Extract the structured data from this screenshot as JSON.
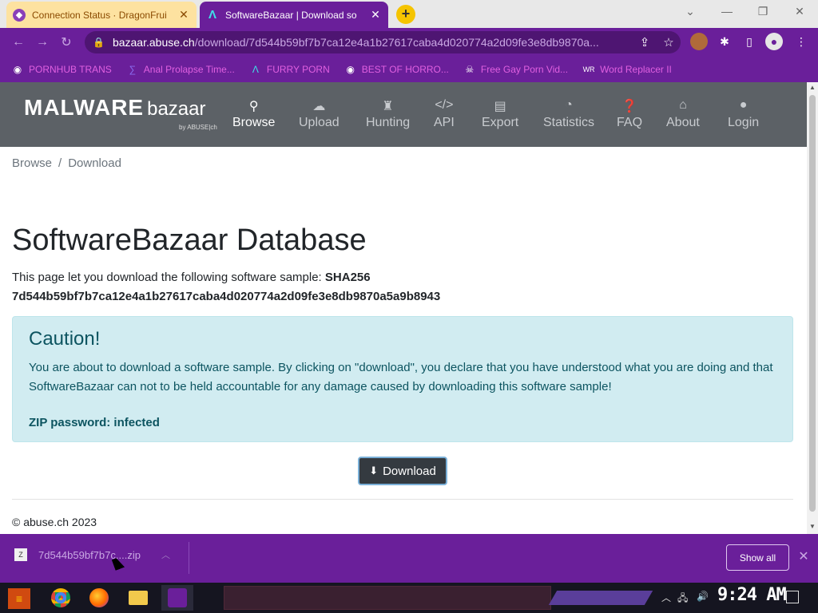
{
  "browser": {
    "tabs": [
      {
        "title": "Connection Status · DragonFrui",
        "favicon": "dragonfruit-icon",
        "close": "✕"
      },
      {
        "title": "SoftwareBazaar | Download so",
        "favicon": "bazaar-icon",
        "close": "✕"
      }
    ],
    "new_tab": "+",
    "window_controls": {
      "chevron": "⌄",
      "minimize": "—",
      "restore": "❐",
      "close": "✕"
    },
    "url_host": "bazaar.abuse.ch",
    "url_path": "/download/7d544b59bf7b7ca12e4a1b27617caba4d020774a2d09fe3e8db9870a...",
    "bookmarks": [
      {
        "label": "PORNHUB TRANS",
        "icon": "globe-icon"
      },
      {
        "label": "Anal Prolapse Time...",
        "icon": "bookmark-icon"
      },
      {
        "label": "FURRY PORN",
        "icon": "bazaar-icon"
      },
      {
        "label": "BEST OF HORRO...",
        "icon": "globe-icon"
      },
      {
        "label": "Free Gay Porn Vid...",
        "icon": "skull-icon"
      },
      {
        "label": "Word Replacer II",
        "icon": "wr-icon"
      }
    ]
  },
  "site": {
    "logo_main": "MALWARE",
    "logo_sub": "bazaar",
    "logo_by": "by ABUSE|ch",
    "nav": [
      {
        "label": "Browse",
        "icon": "search-icon",
        "glyph": "🔍"
      },
      {
        "label": "Upload",
        "icon": "cloud-upload-icon",
        "glyph": "☁"
      },
      {
        "label": "Hunting",
        "icon": "chess-rook-icon",
        "glyph": "♜"
      },
      {
        "label": "API",
        "icon": "code-icon",
        "glyph": "</>"
      },
      {
        "label": "Export",
        "icon": "file-export-icon",
        "glyph": "⎘"
      },
      {
        "label": "Statistics",
        "icon": "pie-chart-icon",
        "glyph": "◔"
      },
      {
        "label": "FAQ",
        "icon": "question-icon",
        "glyph": "?"
      },
      {
        "label": "About",
        "icon": "landmark-icon",
        "glyph": "⌂"
      },
      {
        "label": "Login",
        "icon": "user-icon",
        "glyph": "●"
      }
    ]
  },
  "page": {
    "breadcrumb": [
      "Browse",
      "Download"
    ],
    "title": "SoftwareBazaar Database",
    "intro": "This page let you download the following software sample:",
    "hash_label": "SHA256",
    "hash": "7d544b59bf7b7ca12e4a1b27617caba4d020774a2d09fe3e8db9870a5a9b8943",
    "caution_title": "Caution!",
    "caution_text": "You are about to download a software sample. By clicking on \"download\", you declare that you have understood what you are doing and that SoftwareBazaar can not to be held accountable for any damage caused by downloading this software sample!",
    "zip_password": "ZIP password: infected",
    "download_label": "Download",
    "footer": "© abuse.ch 2023"
  },
  "download_shelf": {
    "file": "7d544b59bf7b7c....zip",
    "show_all": "Show all"
  },
  "taskbar": {
    "clock": "9:24 AM"
  }
}
